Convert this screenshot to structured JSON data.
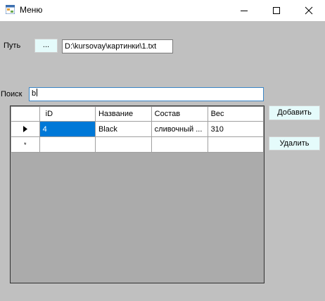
{
  "window": {
    "title": "Меню",
    "icon": "form-icon",
    "controls": [
      "minimize-icon",
      "maximize-icon",
      "close-icon"
    ]
  },
  "path": {
    "label": "Путь",
    "browse_label": "...",
    "value": "D:\\kursovay\\картинки\\1.txt"
  },
  "search": {
    "label": "Поиск",
    "value": "b"
  },
  "actions": {
    "add_label": "Добавить",
    "delete_label": "Удалить"
  },
  "grid": {
    "columns": [
      "iD",
      "Название",
      "Состав",
      "Вес"
    ],
    "rows": [
      {
        "indicator": "current-row-icon",
        "cells": [
          "4",
          "Black",
          "сливочный ...",
          "310"
        ]
      }
    ],
    "new_row_indicator": "*"
  },
  "colors": {
    "background": "#c0c0c0",
    "button_bg": "#e5fbfb",
    "selection": "#0078d7",
    "focus_border": "#3b86c6"
  }
}
